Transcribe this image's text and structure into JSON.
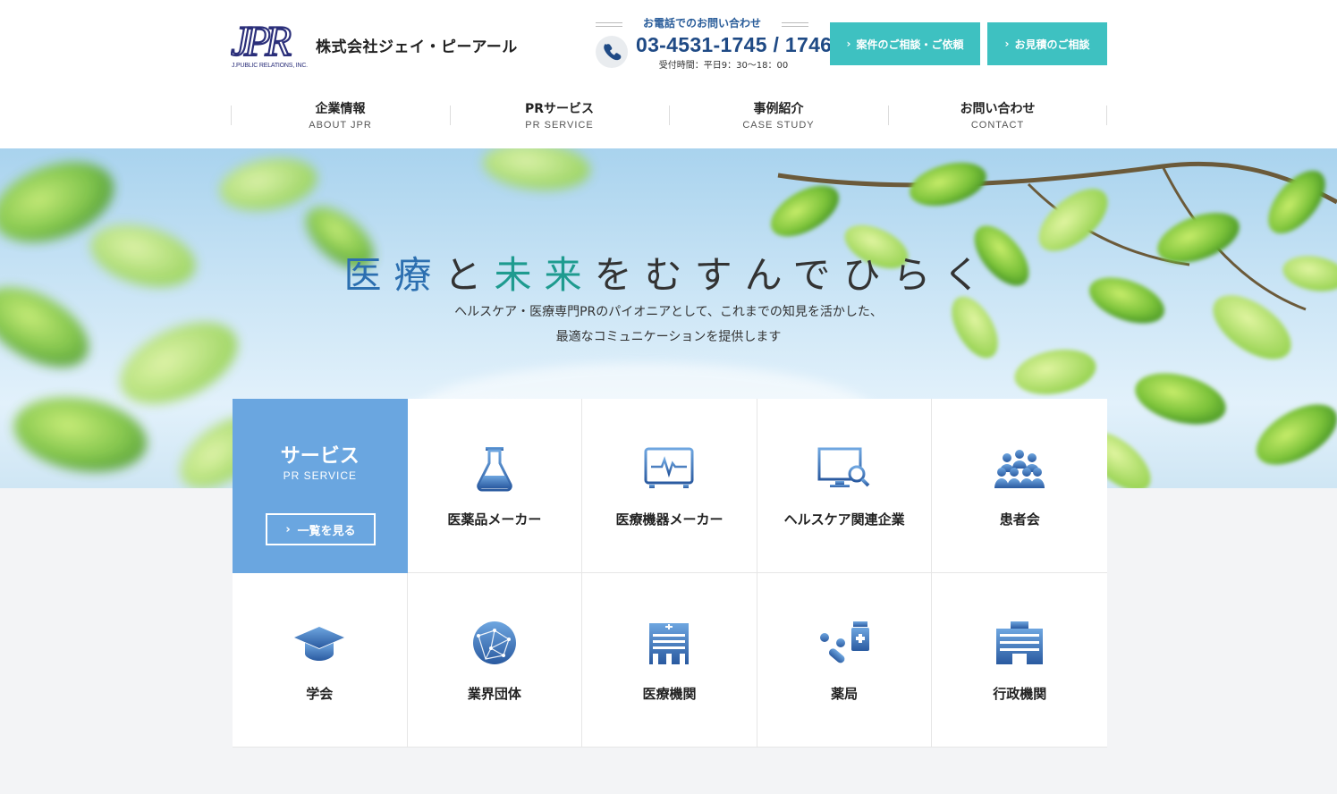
{
  "header": {
    "logo_text": "JPR",
    "logo_sub": "J.PUBLIC RELATIONS, INC.",
    "company_name": "株式会社ジェイ・ピーアール",
    "tel_label": "お電話でのお問い合わせ",
    "tel_number": "03-4531-1745 / 1746",
    "tel_hours": "受付時間：平日9：30〜18：00",
    "cta_inquiry": "案件のご相談・ご依頼",
    "cta_estimate": "お見積のご相談",
    "chevron": "›"
  },
  "nav": [
    {
      "jp": "企業情報",
      "en": "ABOUT JPR"
    },
    {
      "jp": "PRサービス",
      "en": "PR SERVICE"
    },
    {
      "jp": "事例紹介",
      "en": "CASE STUDY"
    },
    {
      "jp": "お問い合わせ",
      "en": "CONTACT"
    }
  ],
  "hero": {
    "title_a": "医療",
    "title_b": "と",
    "title_c": "未来",
    "title_d": "をむすんでひらく",
    "sub1": "ヘルスケア・医療専門PRのパイオニアとして、これまでの知見を活かした、",
    "sub2": "最適なコミュニケーションを提供します"
  },
  "services": {
    "heading": "サービス",
    "heading_en": "PR SERVICE",
    "view_all": "一覧を見る",
    "items": [
      {
        "label": "医薬品メーカー",
        "icon": "flask-icon"
      },
      {
        "label": "医療機器メーカー",
        "icon": "monitor-ecg-icon"
      },
      {
        "label": "ヘルスケア関連企業",
        "icon": "computer-search-icon"
      },
      {
        "label": "患者会",
        "icon": "people-group-icon"
      },
      {
        "label": "学会",
        "icon": "graduation-cap-icon"
      },
      {
        "label": "業界団体",
        "icon": "globe-network-icon"
      },
      {
        "label": "医療機関",
        "icon": "hospital-icon"
      },
      {
        "label": "薬局",
        "icon": "pills-bottle-icon"
      },
      {
        "label": "行政機関",
        "icon": "government-building-icon"
      }
    ]
  },
  "colors": {
    "accent_teal": "#3ec1c1",
    "service_blue": "#6aa6e0",
    "nav_blue": "#1f4a85"
  }
}
